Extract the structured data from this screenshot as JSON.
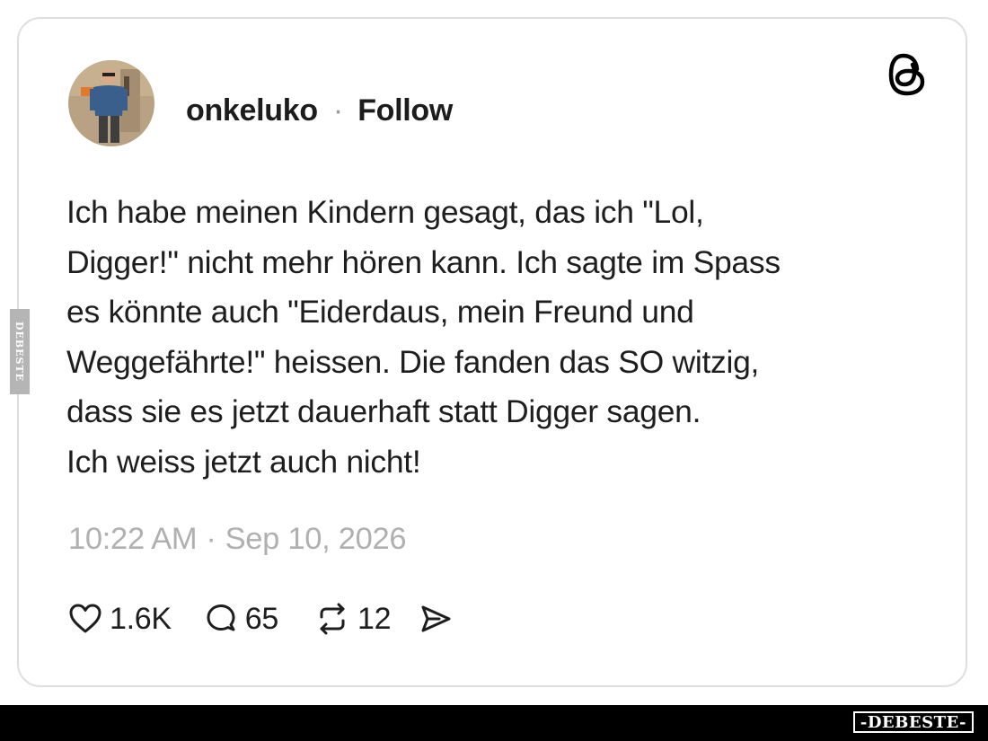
{
  "post": {
    "username": "onkeluko",
    "separator": "·",
    "follow_label": "Follow",
    "text": "Ich habe meinen Kindern gesagt, das ich \"Lol,\nDigger!\" nicht mehr hören kann. Ich sagte im Spass\nes könnte auch \"Eiderdaus, mein Freund und\nWeggefährte!\" heissen. Die fanden das SO witzig,\ndass sie es jetzt dauerhaft statt Digger sagen.\nIch weiss jetzt auch nicht!",
    "time": "10:22 AM",
    "date": "Sep 10, 2026"
  },
  "actions": {
    "likes": "1.6K",
    "replies": "65",
    "reposts": "12"
  },
  "icons": {
    "logo": "threads-logo-icon",
    "like": "heart-icon",
    "reply": "speech-bubble-icon",
    "repost": "repost-arrows-icon",
    "share": "send-icon"
  },
  "watermark": {
    "side": "DEBESTE",
    "bottom": "-DEBESTE-"
  },
  "colors": {
    "text": "#1e1e1e",
    "muted": "#b0b0b0",
    "card_border": "#dedede",
    "bottom_bar": "#000000"
  }
}
